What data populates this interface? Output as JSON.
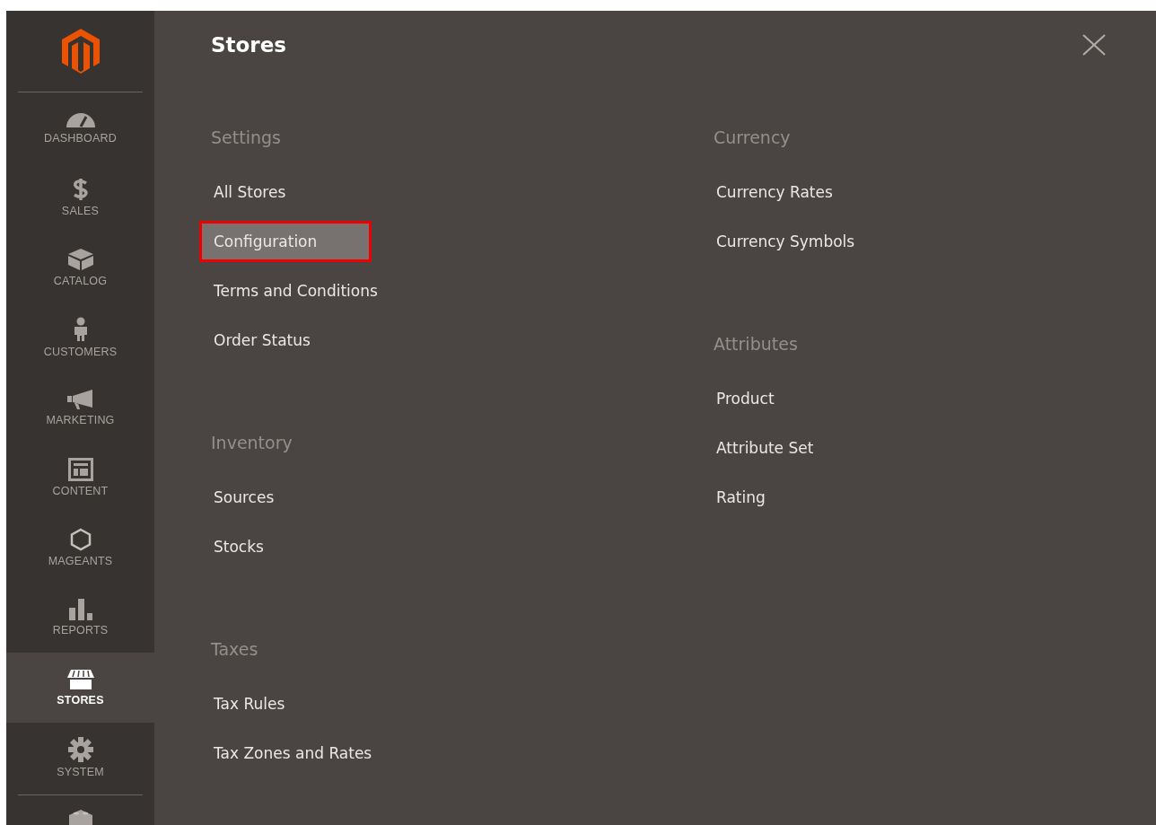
{
  "sidebar": {
    "items": [
      {
        "label": "DASHBOARD",
        "selected": false
      },
      {
        "label": "SALES",
        "selected": false
      },
      {
        "label": "CATALOG",
        "selected": false
      },
      {
        "label": "CUSTOMERS",
        "selected": false
      },
      {
        "label": "MARKETING",
        "selected": false
      },
      {
        "label": "CONTENT",
        "selected": false
      },
      {
        "label": "MAGEANTS",
        "selected": false
      },
      {
        "label": "REPORTS",
        "selected": false
      },
      {
        "label": "STORES",
        "selected": true
      },
      {
        "label": "SYSTEM",
        "selected": false
      }
    ]
  },
  "panel": {
    "title": "Stores",
    "columns": [
      {
        "groups": [
          {
            "heading": "Settings",
            "links": [
              {
                "label": "All Stores",
                "selected": false
              },
              {
                "label": "Configuration",
                "selected": true
              },
              {
                "label": "Terms and Conditions",
                "selected": false
              },
              {
                "label": "Order Status",
                "selected": false
              }
            ]
          },
          {
            "heading": "Inventory",
            "links": [
              {
                "label": "Sources",
                "selected": false
              },
              {
                "label": "Stocks",
                "selected": false
              }
            ]
          },
          {
            "heading": "Taxes",
            "links": [
              {
                "label": "Tax Rules",
                "selected": false
              },
              {
                "label": "Tax Zones and Rates",
                "selected": false
              }
            ]
          }
        ]
      },
      {
        "groups": [
          {
            "heading": "Currency",
            "links": [
              {
                "label": "Currency Rates",
                "selected": false
              },
              {
                "label": "Currency Symbols",
                "selected": false
              }
            ]
          },
          {
            "heading": "Attributes",
            "links": [
              {
                "label": "Product",
                "selected": false
              },
              {
                "label": "Attribute Set",
                "selected": false
              },
              {
                "label": "Rating",
                "selected": false
              }
            ]
          }
        ]
      }
    ]
  }
}
